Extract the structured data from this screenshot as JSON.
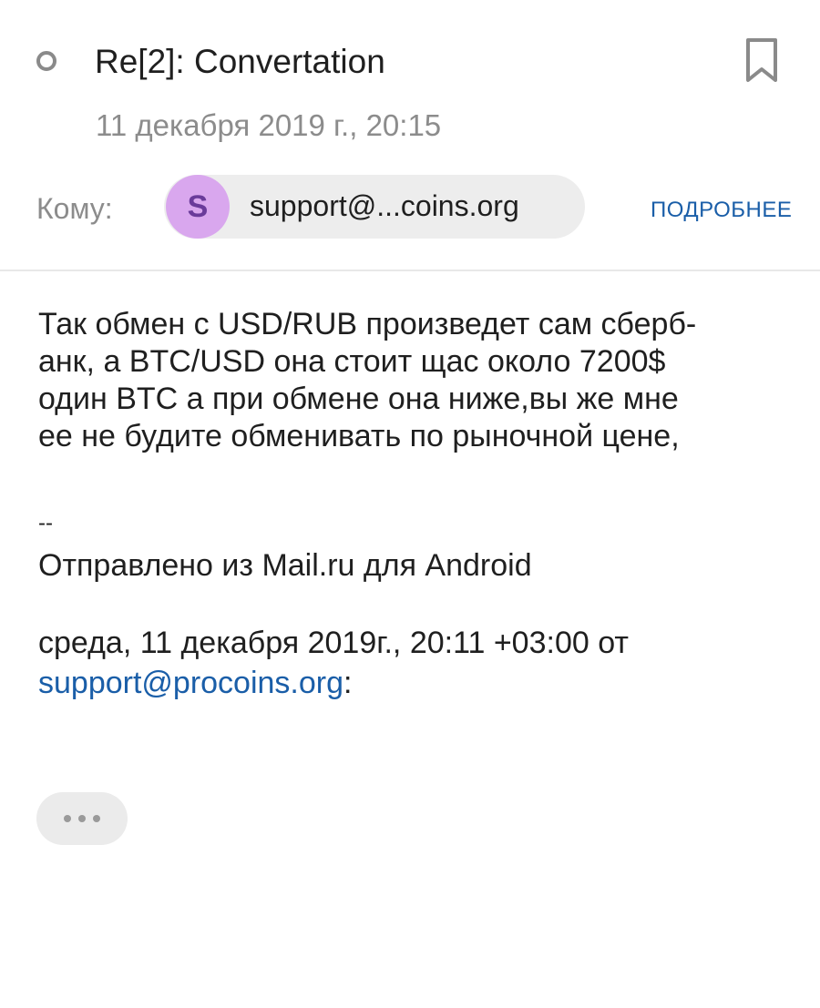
{
  "message": {
    "subject": "Re[2]: Convertation",
    "date": "11 декабря 2019 г., 20:15",
    "to_label": "Кому:",
    "recipient": {
      "initial": "S",
      "email_short": "support@...coins.org",
      "avatar_color": "#d9a7ee"
    },
    "details_link": "ПОДРОБНЕЕ",
    "body_lines": [
      "Так обмен с USD/RUB произведет сам сберб-",
      "анк, а BTC/USD она стоит щас около 7200$",
      "один BTC а при обмене она ниже,вы же мне",
      "ее не будите обменивать по рыночной цене,"
    ],
    "signature_separator": "--",
    "signature": "Отправлено из Mail.ru для Android",
    "quote_header_prefix": "среда, 11 декабря 2019г., 20:11 +03:00 от",
    "quote_header_email": "support@procoins.org",
    "quote_header_suffix": ":"
  },
  "icons": {
    "unread": "unread-circle-icon",
    "bookmark": "bookmark-icon",
    "more": "more-dots-icon"
  },
  "colors": {
    "link": "#1a5ea8",
    "muted": "#8c8c8c"
  }
}
